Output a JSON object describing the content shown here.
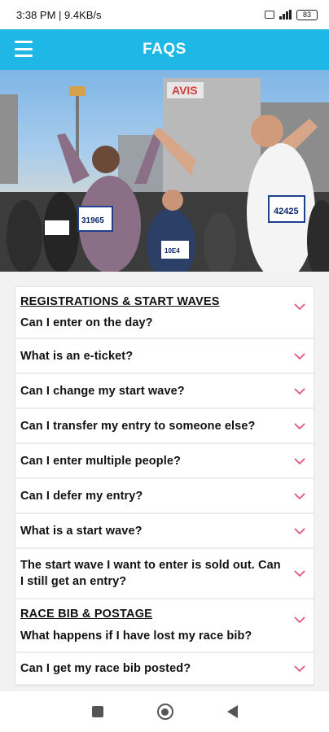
{
  "status_bar": {
    "time": "3:38 PM | 9.4KB/s",
    "battery": "83"
  },
  "header": {
    "title": "FAQS"
  },
  "colors": {
    "accent": "#1fb7e6",
    "chevron": "#e0497f"
  },
  "sections": [
    {
      "title": "REGISTRATIONS & START WAVES",
      "items": [
        "Can I enter on the day?",
        "What is an e-ticket?",
        "Can I change my start wave?",
        "Can I transfer my entry to someone else?",
        "Can I enter multiple people?",
        "Can I defer my entry?",
        "What is a start wave?",
        "The start wave I want to enter is sold out. Can I still get an entry?"
      ]
    },
    {
      "title": "RACE BIB & POSTAGE",
      "items": [
        "What happens if I have lost my race bib?",
        "Can I get my race bib posted?"
      ]
    }
  ],
  "hero": {
    "bibs": [
      "31965",
      "42425",
      "10E4"
    ],
    "sign_text": "AVIS"
  }
}
